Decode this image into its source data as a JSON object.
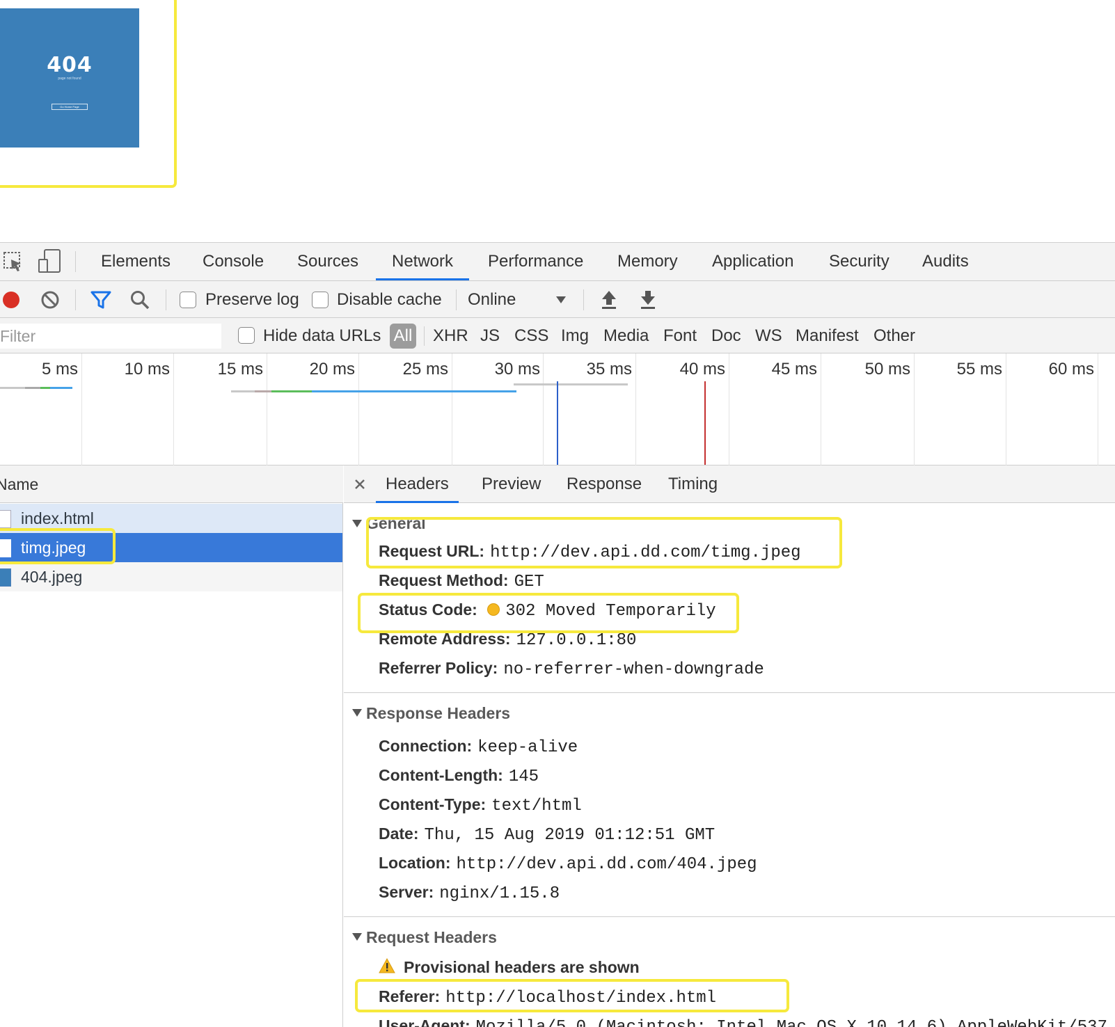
{
  "preview": {
    "title": "404",
    "subtitle": "page not found",
    "button": "Go Home Page"
  },
  "main_tabs": [
    "Elements",
    "Console",
    "Sources",
    "Network",
    "Performance",
    "Memory",
    "Application",
    "Security",
    "Audits"
  ],
  "active_tab": "Network",
  "toolbar": {
    "preserve_log": "Preserve log",
    "disable_cache": "Disable cache",
    "throttle": "Online"
  },
  "filter": {
    "placeholder": "Filter",
    "hide_data_urls": "Hide data URLs",
    "types": [
      "All",
      "XHR",
      "JS",
      "CSS",
      "Img",
      "Media",
      "Font",
      "Doc",
      "WS",
      "Manifest",
      "Other"
    ]
  },
  "timeline": {
    "ticks": [
      "5 ms",
      "10 ms",
      "15 ms",
      "20 ms",
      "25 ms",
      "30 ms",
      "35 ms",
      "40 ms",
      "45 ms",
      "50 ms",
      "55 ms",
      "60 ms"
    ]
  },
  "requests": {
    "header": "Name",
    "items": [
      "index.html",
      "timg.jpeg",
      "404.jpeg"
    ],
    "selected": "timg.jpeg"
  },
  "detail_tabs": [
    "Headers",
    "Preview",
    "Response",
    "Timing"
  ],
  "general": {
    "title": "General",
    "rows": [
      {
        "k": "Request URL:",
        "v": "http://dev.api.dd.com/timg.jpeg"
      },
      {
        "k": "Request Method:",
        "v": "GET"
      },
      {
        "k": "Status Code:",
        "v": "302 Moved Temporarily"
      },
      {
        "k": "Remote Address:",
        "v": "127.0.0.1:80"
      },
      {
        "k": "Referrer Policy:",
        "v": "no-referrer-when-downgrade"
      }
    ]
  },
  "response_headers": {
    "title": "Response Headers",
    "rows": [
      {
        "k": "Connection:",
        "v": "keep-alive"
      },
      {
        "k": "Content-Length:",
        "v": "145"
      },
      {
        "k": "Content-Type:",
        "v": "text/html"
      },
      {
        "k": "Date:",
        "v": "Thu, 15 Aug 2019 01:12:51 GMT"
      },
      {
        "k": "Location:",
        "v": "http://dev.api.dd.com/404.jpeg"
      },
      {
        "k": "Server:",
        "v": "nginx/1.15.8"
      }
    ]
  },
  "request_headers": {
    "title": "Request Headers",
    "warning": "Provisional headers are shown",
    "rows": [
      {
        "k": "Referer:",
        "v": "http://localhost/index.html"
      },
      {
        "k": "User-Agent:",
        "v": "Mozilla/5.0 (Macintosh; Intel Mac OS X 10_14_6) AppleWebKit/537"
      }
    ]
  },
  "colors": {
    "accent": "#1a73e8",
    "highlight": "#f6e93d",
    "selected_row": "#3879d9",
    "status_dot": "#f5b820",
    "record": "#d93025"
  }
}
